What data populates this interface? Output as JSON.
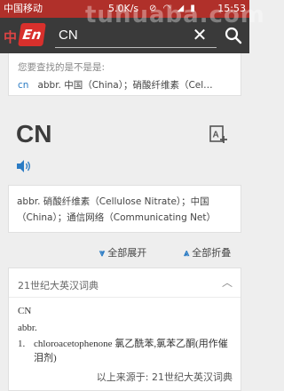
{
  "status_bar": {
    "carrier": "中国移动",
    "speed": "5.0K/s",
    "time": "15:53"
  },
  "watermark": "tuhuaba.com",
  "header": {
    "logo_text": "En",
    "logo_prefix": "中",
    "search_value": "CN"
  },
  "suggestion": {
    "hint": "您要查找的是不是是:",
    "word": "cn",
    "definition": "abbr. 中国（China）；硝酸纤维素（Cel…"
  },
  "entry": {
    "headword": "CN",
    "definition": "abbr. 硝酸纤维素（Cellulose Nitrate）；中国（China）；通信网络（Communicating Net）"
  },
  "controls": {
    "expand_all": "全部展开",
    "collapse_all": "全部折叠"
  },
  "dictionary": {
    "title": "21世纪大英汉词典",
    "word": "CN",
    "pos": "abbr.",
    "sense_number": "1.",
    "sense": "chloroacetophenone 氯乙酰苯,氯苯乙酮(用作催泪剂)",
    "source": "以上来源于: 21世纪大英汉词典"
  },
  "colors": {
    "status_bar": "#b0302a",
    "header": "#3a3a3a",
    "logo": "#d8302c",
    "accent": "#2a7bc4"
  }
}
